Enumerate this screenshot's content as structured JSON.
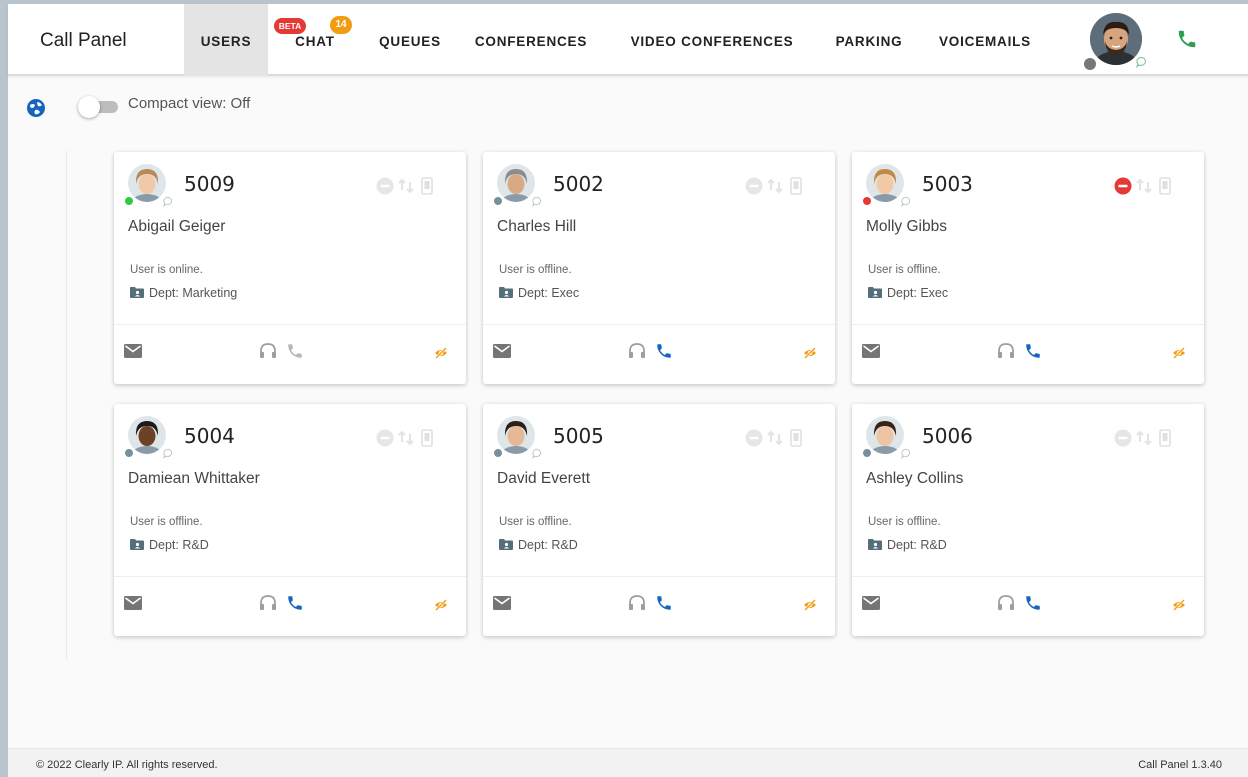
{
  "header": {
    "app_title": "Call Panel",
    "tabs": [
      {
        "label": "USERS",
        "active": true
      },
      {
        "label": "CHAT",
        "badge_beta": "BETA",
        "badge_count": "14"
      },
      {
        "label": "QUEUES"
      },
      {
        "label": "CONFERENCES"
      },
      {
        "label": "VIDEO CONFERENCES"
      },
      {
        "label": "PARKING"
      },
      {
        "label": "VOICEMAILS"
      }
    ],
    "user_status_color": "#777777",
    "phone_color": "#2e9e4f"
  },
  "toolbar": {
    "compact_view_label": "Compact view: Off",
    "compact_view_on": false,
    "globe_icon": "globe-icon"
  },
  "colors": {
    "online": "#2ecc40",
    "offline": "#78909c",
    "dnd": "#e53935",
    "phone_active": "#1565c0",
    "icon_gray": "#9e9e9e",
    "hide_orange": "#f39c12"
  },
  "users": [
    {
      "ext": "5009",
      "name": "Abigail Geiger",
      "status_text": "User is online.",
      "dept": "Dept: Marketing",
      "presence": "online",
      "dnd": false,
      "phone_active": false,
      "skin": "#f0c9a9",
      "hair": "#b88a5a"
    },
    {
      "ext": "5002",
      "name": "Charles Hill",
      "status_text": "User is offline.",
      "dept": "Dept: Exec",
      "presence": "offline",
      "dnd": false,
      "phone_active": true,
      "skin": "#d9a884",
      "hair": "#8c8c8c"
    },
    {
      "ext": "5003",
      "name": "Molly Gibbs",
      "status_text": "User is offline.",
      "dept": "Dept: Exec",
      "presence": "dnd",
      "dnd": true,
      "phone_active": true,
      "skin": "#f2c9a5",
      "hair": "#c38a45"
    },
    {
      "ext": "5004",
      "name": "Damiean Whittaker",
      "status_text": "User is offline.",
      "dept": "Dept: R&D",
      "presence": "offline",
      "dnd": false,
      "phone_active": true,
      "skin": "#6b4226",
      "hair": "#1f1a17"
    },
    {
      "ext": "5005",
      "name": "David Everett",
      "status_text": "User is offline.",
      "dept": "Dept: R&D",
      "presence": "offline",
      "dnd": false,
      "phone_active": true,
      "skin": "#e6b894",
      "hair": "#2b2018"
    },
    {
      "ext": "5006",
      "name": "Ashley Collins",
      "status_text": "User is offline.",
      "dept": "Dept: R&D",
      "presence": "offline",
      "dnd": false,
      "phone_active": true,
      "skin": "#eec4a3",
      "hair": "#3a2418"
    }
  ],
  "footer": {
    "copyright": "© 2022 Clearly IP. All rights reserved.",
    "version": "Call Panel 1.3.40"
  }
}
